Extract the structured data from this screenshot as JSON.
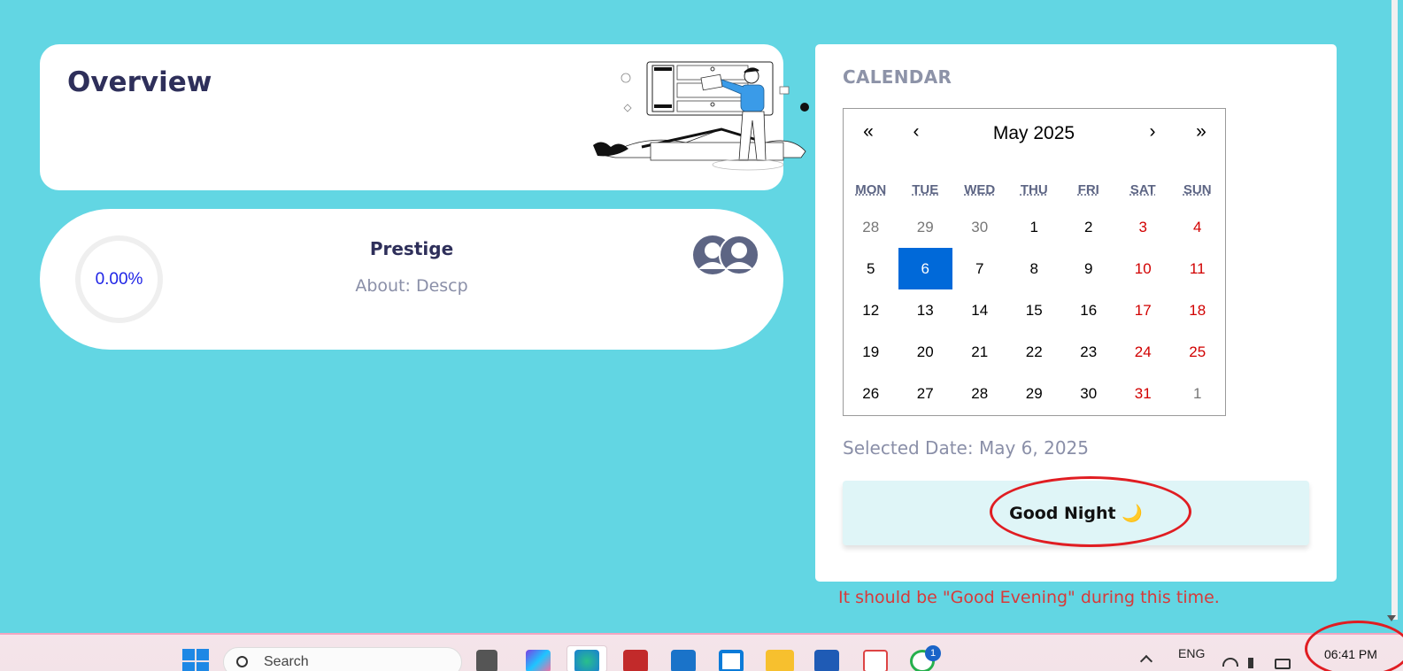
{
  "overview": {
    "title": "Overview"
  },
  "profile": {
    "progress": "0.00%",
    "name": "Prestige",
    "about": "About: Descp"
  },
  "calendar": {
    "title": "CALENDAR",
    "month_label": "May 2025",
    "nav": {
      "prev_year": "«",
      "prev_month": "‹",
      "next_month": "›",
      "next_year": "»"
    },
    "weekdays": [
      "MON",
      "TUE",
      "WED",
      "THU",
      "FRI",
      "SAT",
      "SUN"
    ],
    "days": [
      {
        "d": "28",
        "t": "other"
      },
      {
        "d": "29",
        "t": "other"
      },
      {
        "d": "30",
        "t": "other"
      },
      {
        "d": "1",
        "t": ""
      },
      {
        "d": "2",
        "t": ""
      },
      {
        "d": "3",
        "t": "weekend"
      },
      {
        "d": "4",
        "t": "weekend"
      },
      {
        "d": "5",
        "t": ""
      },
      {
        "d": "6",
        "t": "selected"
      },
      {
        "d": "7",
        "t": ""
      },
      {
        "d": "8",
        "t": ""
      },
      {
        "d": "9",
        "t": ""
      },
      {
        "d": "10",
        "t": "weekend"
      },
      {
        "d": "11",
        "t": "weekend"
      },
      {
        "d": "12",
        "t": ""
      },
      {
        "d": "13",
        "t": ""
      },
      {
        "d": "14",
        "t": ""
      },
      {
        "d": "15",
        "t": ""
      },
      {
        "d": "16",
        "t": ""
      },
      {
        "d": "17",
        "t": "weekend"
      },
      {
        "d": "18",
        "t": "weekend"
      },
      {
        "d": "19",
        "t": ""
      },
      {
        "d": "20",
        "t": ""
      },
      {
        "d": "21",
        "t": ""
      },
      {
        "d": "22",
        "t": ""
      },
      {
        "d": "23",
        "t": ""
      },
      {
        "d": "24",
        "t": "weekend"
      },
      {
        "d": "25",
        "t": "weekend"
      },
      {
        "d": "26",
        "t": ""
      },
      {
        "d": "27",
        "t": ""
      },
      {
        "d": "28",
        "t": ""
      },
      {
        "d": "29",
        "t": ""
      },
      {
        "d": "30",
        "t": ""
      },
      {
        "d": "31",
        "t": "weekend"
      },
      {
        "d": "1",
        "t": "other"
      }
    ],
    "selected_date": "Selected Date: May 6, 2025"
  },
  "greeting": {
    "text": "Good Night 🌙"
  },
  "annotation": {
    "note": "It should be \"Good Evening\" during this time."
  },
  "taskbar": {
    "search_placeholder": "Search",
    "language": "ENG",
    "time": "06:41 PM",
    "whatsapp_badge": "1"
  },
  "colors": {
    "background": "#62d6e3",
    "selected_day": "#0069d9",
    "weekend_day": "#d10000",
    "annotation_red": "#e01d22"
  }
}
